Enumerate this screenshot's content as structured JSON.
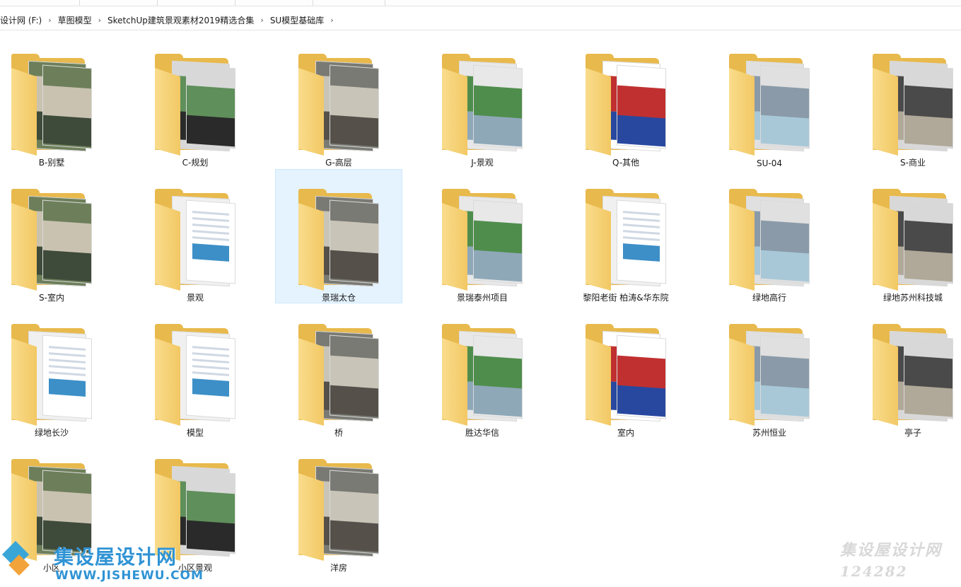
{
  "breadcrumb": {
    "items": [
      "设计网 (F:)",
      "草图模型",
      "SketchUp建筑景观素材2019精选合集",
      "SU模型基础库"
    ],
    "separator": "›"
  },
  "folders": [
    {
      "label": "B-别墅",
      "preview": "photo"
    },
    {
      "label": "C-规划",
      "preview": "photo"
    },
    {
      "label": "G-高层",
      "preview": "photo"
    },
    {
      "label": "J-景观",
      "preview": "photo"
    },
    {
      "label": "Q-其他",
      "preview": "photo"
    },
    {
      "label": "SU-04",
      "preview": "photo"
    },
    {
      "label": "S-商业",
      "preview": "photo"
    },
    {
      "label": "S-室内",
      "preview": "photo"
    },
    {
      "label": "景观",
      "preview": "document"
    },
    {
      "label": "景瑞太仓",
      "preview": "photo",
      "selected": true
    },
    {
      "label": "景瑞泰州项目",
      "preview": "photo"
    },
    {
      "label": "黎阳老街 柏涛&华东院",
      "preview": "document"
    },
    {
      "label": "绿地高行",
      "preview": "photo"
    },
    {
      "label": "绿地苏州科技城",
      "preview": "photo"
    },
    {
      "label": "绿地长沙",
      "preview": "document"
    },
    {
      "label": "模型",
      "preview": "document"
    },
    {
      "label": "桥",
      "preview": "photo"
    },
    {
      "label": "胜达华信",
      "preview": "photo"
    },
    {
      "label": "室内",
      "preview": "photo"
    },
    {
      "label": "苏州恒业",
      "preview": "photo"
    },
    {
      "label": "亭子",
      "preview": "photo"
    },
    {
      "label": "小区",
      "preview": "photo"
    },
    {
      "label": "小区景观",
      "preview": "photo"
    },
    {
      "label": "洋房",
      "preview": "photo"
    }
  ],
  "watermark": {
    "title": "集设屋设计网",
    "url": "WWW.JISHEWU.COM",
    "right_title": "集设屋设计网",
    "right_number": "124282"
  },
  "colors": {
    "folder_back": "#e8b94c",
    "folder_front": "#f7d47a",
    "selection": "#e5f3ff",
    "watermark_blue": "#2f93d4"
  },
  "icons": [
    "chevron-right-icon",
    "folder-icon"
  ]
}
